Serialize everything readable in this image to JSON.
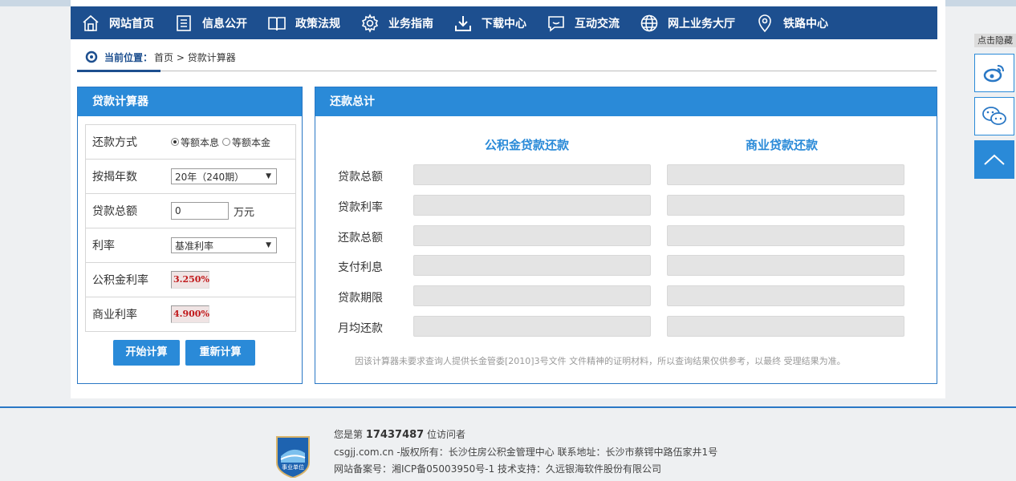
{
  "nav": {
    "items": [
      {
        "label": "网站首页",
        "icon": "home-icon"
      },
      {
        "label": "信息公开",
        "icon": "document-icon"
      },
      {
        "label": "政策法规",
        "icon": "book-icon"
      },
      {
        "label": "业务指南",
        "icon": "gear-icon"
      },
      {
        "label": "下载中心",
        "icon": "download-icon"
      },
      {
        "label": "互动交流",
        "icon": "chat-icon"
      },
      {
        "label": "网上业务大厅",
        "icon": "globe-icon"
      },
      {
        "label": "铁路中心",
        "icon": "location-icon"
      }
    ]
  },
  "breadcrumb": {
    "label": "当前位置：",
    "path": "首页 > 贷款计算器"
  },
  "calculator": {
    "title": "贷款计算器",
    "repay_method": {
      "label": "还款方式",
      "option1": "等额本息",
      "option2": "等额本金",
      "selected": "等额本息"
    },
    "years": {
      "label": "按揭年数",
      "value": "20年（240期）"
    },
    "amount": {
      "label": "贷款总额",
      "value": "0",
      "unit": "万元"
    },
    "rate_type": {
      "label": "利率",
      "value": "基准利率"
    },
    "fund_rate": {
      "label": "公积金利率",
      "value": "3.250%"
    },
    "biz_rate": {
      "label": "商业利率",
      "value": "4.900%"
    },
    "start_button": "开始计算",
    "reset_button": "重新计算"
  },
  "summary": {
    "title": "还款总计",
    "col_fund": "公积金贷款还款",
    "col_biz": "商业贷款还款",
    "rows": [
      "贷款总额",
      "贷款利率",
      "还款总额",
      "支付利息",
      "贷款期限",
      "月均还款"
    ],
    "note": "因该计算器未要求查询人提供长金管委[2010]3号文件 文件精神的证明材料，所以查询结果仅供参考，以最终 受理结果为准。"
  },
  "sidebar": {
    "hide_label": "点击隐藏",
    "weibo_icon": "weibo-icon",
    "wechat_icon": "wechat-icon",
    "top_icon": "chevron-up-icon"
  },
  "footer": {
    "visitor_prefix": "您是第",
    "visitor_count": "17437487",
    "visitor_suffix": "位访问者",
    "copyright": "csgjj.com.cn -版权所有：长沙住房公积金管理中心 联系地址：长沙市蔡锷中路伍家井1号",
    "icp": "网站备案号：湘ICP备05003950号-1 技术支持：久远银海软件股份有限公司",
    "badge_text": "事业单位"
  },
  "colors": {
    "nav": "#1d4f8f",
    "accent": "#2a8ad8",
    "rate": "#c0181a"
  }
}
